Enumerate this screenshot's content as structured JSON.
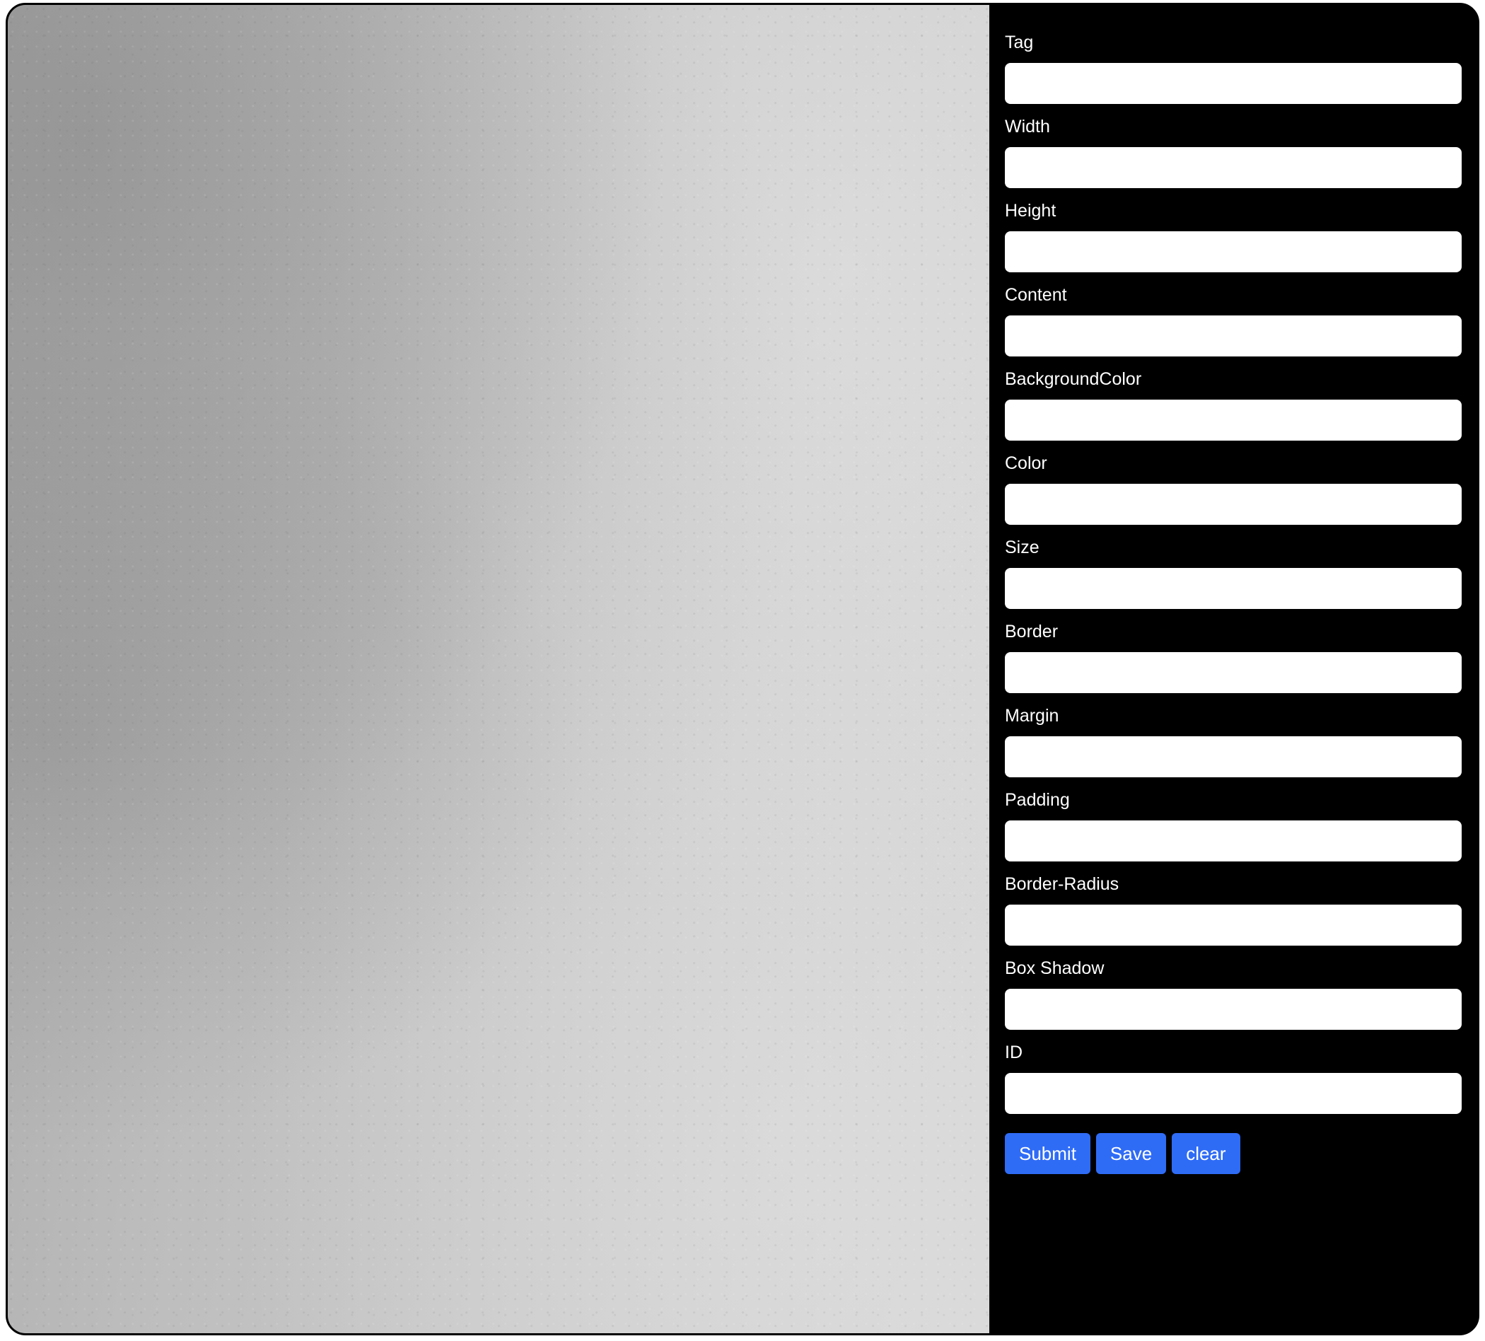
{
  "form": {
    "fields": [
      {
        "label": "Tag",
        "value": ""
      },
      {
        "label": "Width",
        "value": ""
      },
      {
        "label": "Height",
        "value": ""
      },
      {
        "label": "Content",
        "value": ""
      },
      {
        "label": "BackgroundColor",
        "value": ""
      },
      {
        "label": "Color",
        "value": ""
      },
      {
        "label": "Size",
        "value": ""
      },
      {
        "label": "Border",
        "value": ""
      },
      {
        "label": "Margin",
        "value": ""
      },
      {
        "label": "Padding",
        "value": ""
      },
      {
        "label": "Border-Radius",
        "value": ""
      },
      {
        "label": "Box Shadow",
        "value": ""
      },
      {
        "label": "ID",
        "value": ""
      }
    ],
    "buttons": {
      "submit_label": "Submit",
      "save_label": "Save",
      "clear_label": "clear"
    }
  },
  "colors": {
    "panel_background": "#000000",
    "button_accent": "#2f6cf6",
    "canvas_texture": "#c4c4c4"
  }
}
